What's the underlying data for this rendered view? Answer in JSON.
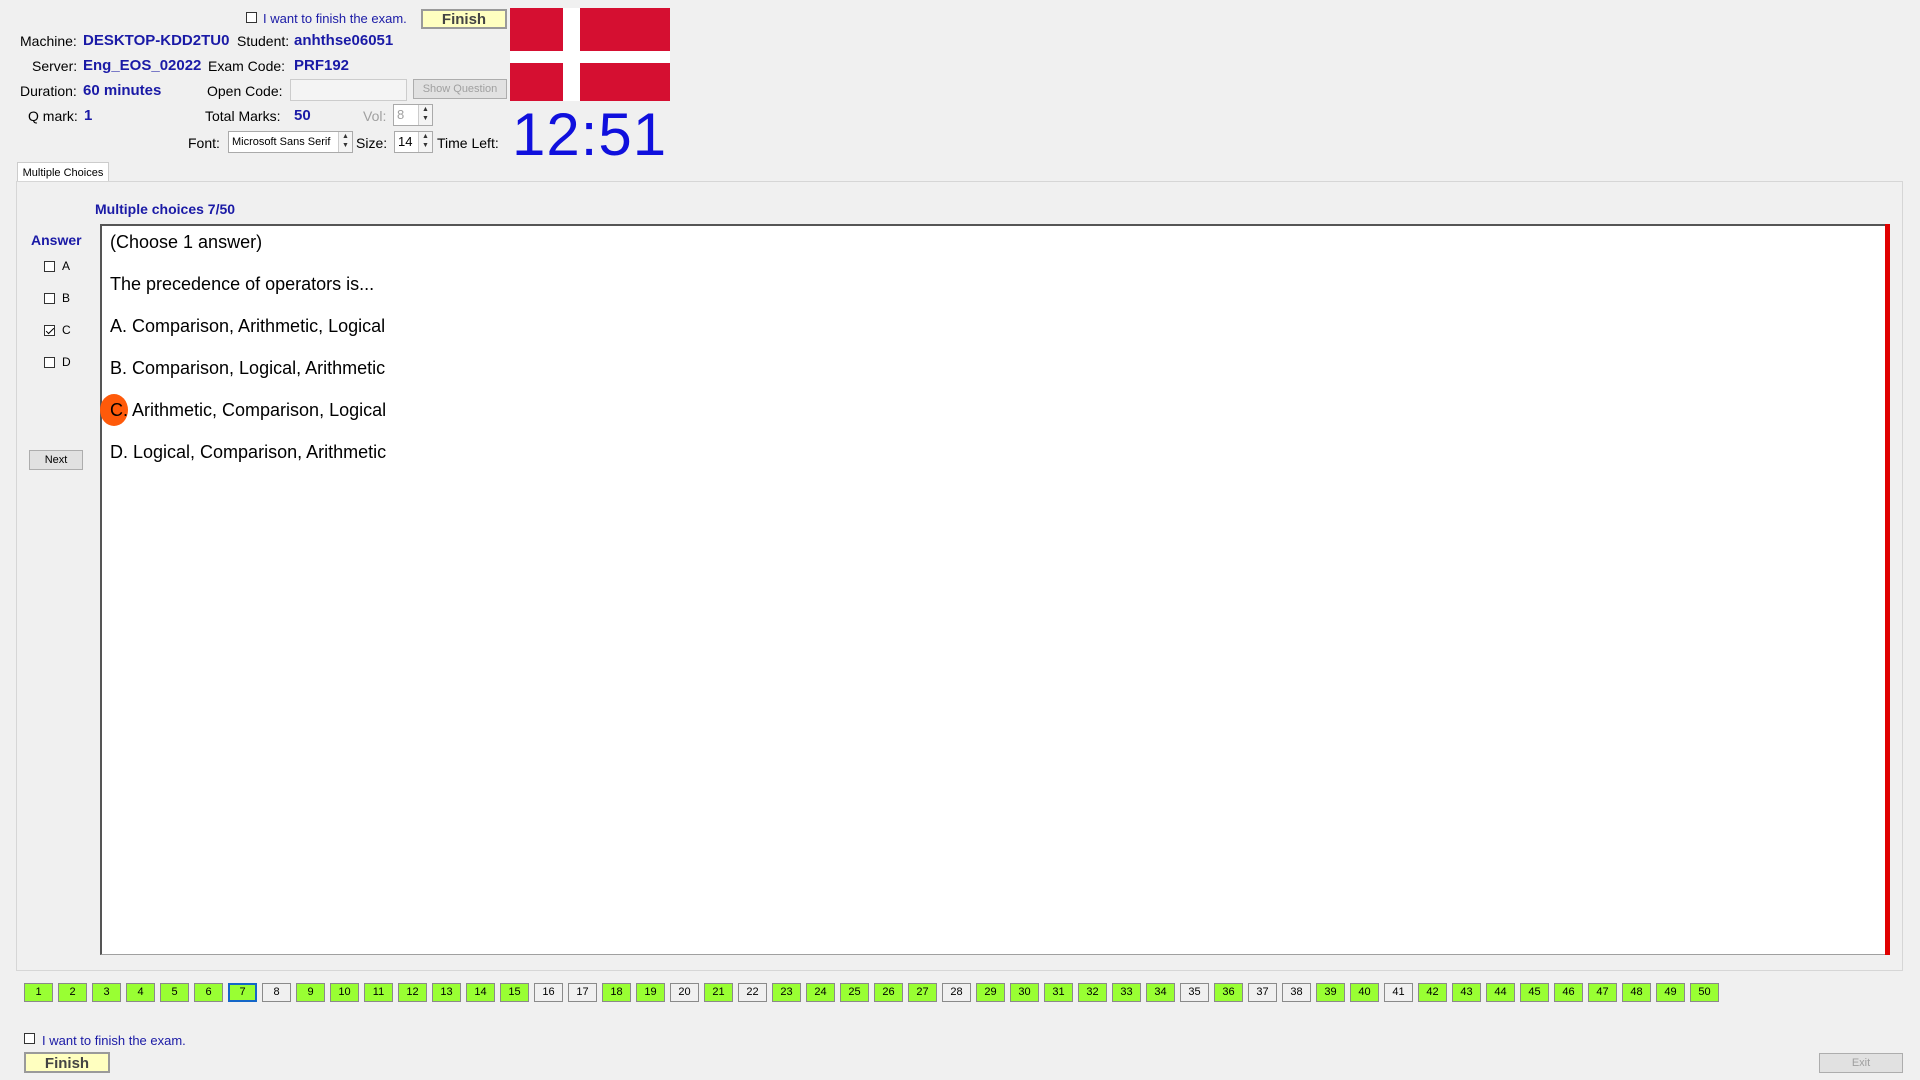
{
  "header": {
    "finish_checkbox_label": "I want to finish the exam.",
    "finish_label": "Finish",
    "machine_label": "Machine:",
    "machine_value": "DESKTOP-KDD2TU0",
    "student_label": "Student:",
    "student_value": "anhthse06051",
    "server_label": "Server:",
    "server_value": "Eng_EOS_02022",
    "exam_code_label": "Exam Code:",
    "exam_code_value": "PRF192",
    "duration_label": "Duration:",
    "duration_value": "60 minutes",
    "open_code_label": "Open Code:",
    "open_code_value": "",
    "show_question_label": "Show Question",
    "qmark_label": "Q mark:",
    "qmark_value": "1",
    "total_marks_label": "Total Marks:",
    "total_marks_value": "50",
    "vol_label": "Vol:",
    "vol_value": "8",
    "font_label": "Font:",
    "font_value": "Microsoft Sans Serif",
    "size_label": "Size:",
    "size_value": "14",
    "time_left_label": "Time Left:",
    "timer": "12:51",
    "flag_colors": {
      "red": "#d50f31",
      "white": "#ffffff"
    }
  },
  "tab": {
    "label": "Multiple Choices"
  },
  "question": {
    "counter": "Multiple choices 7/50",
    "lines": [
      "(Choose 1 answer)",
      "The precedence of operators is...",
      "A.  Comparison,  Arithmetic, Logical",
      "B.  Comparison, Logical, Arithmetic",
      "C.  Arithmetic,  Comparison, Logical",
      "D.  Logical, Comparison,  Arithmetic"
    ]
  },
  "answer": {
    "title": "Answer",
    "options": [
      {
        "label": "A",
        "checked": false
      },
      {
        "label": "B",
        "checked": false
      },
      {
        "label": "C",
        "checked": true
      },
      {
        "label": "D",
        "checked": false
      }
    ],
    "next_label": "Next"
  },
  "navigation": {
    "current": 7,
    "unanswered": [
      8,
      16,
      17,
      20,
      22,
      28,
      35,
      37,
      38,
      41
    ],
    "count": 50
  },
  "footer": {
    "finish_checkbox_label": "I want to finish the exam.",
    "finish_label": "Finish",
    "exit_label": "Exit"
  }
}
